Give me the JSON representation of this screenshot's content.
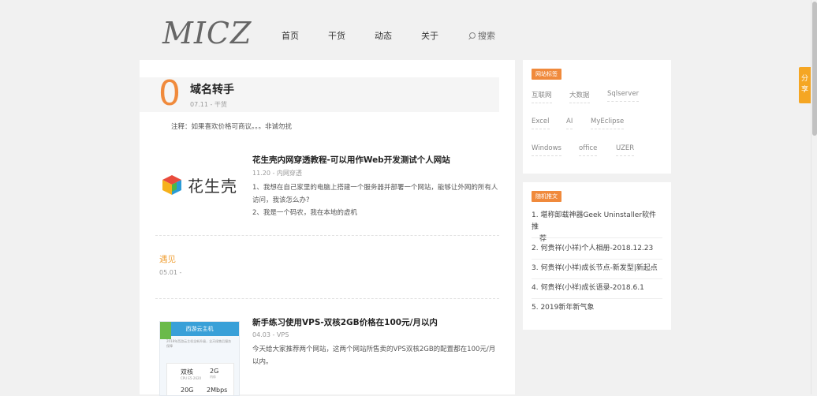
{
  "header": {
    "logo": "MICZ",
    "nav": [
      "首页",
      "干货",
      "动态",
      "关于"
    ],
    "search_label": "搜索"
  },
  "pinned": {
    "count": "0",
    "title": "域名转手",
    "date": "07.11",
    "category": "干货",
    "note": "注释：如果喜欢价格可商议。。。非诚勿扰"
  },
  "posts": [
    {
      "title": "花生壳内网穿透教程-可以用作Web开发测试个人网站",
      "date": "11.20",
      "category": "内网穿透",
      "lines": [
        "1、我想在自己家里的电脑上搭建一个服务器并部署一个网站，能够让外网的所有人",
        "访问，我该怎么办?",
        "2、我是一个码农，我在本地的虚机"
      ],
      "thumb_text": "花生壳"
    },
    {
      "title": "遇见",
      "date": "05.01",
      "category": ""
    },
    {
      "title": "新手练习使用VPS-双核2GB价格在100元/月以内",
      "date": "04.03",
      "category": "VPS",
      "lines": [
        "今天给大家推荐两个网站，这两个网站所售卖的VPS双核2GB的配置都在100元/月",
        "以内。"
      ],
      "thumb": {
        "bar": "西游云主机",
        "small": "2018年西游云主机全新升级，全天候售后服务保障",
        "spec1": "双核",
        "spec1_sub": "CPU E5-2620",
        "spec2": "2G",
        "spec2_sub": "内存",
        "spec3": "20G",
        "spec4": "2Mbps"
      }
    }
  ],
  "sidebar": {
    "tags_title": "网站标签",
    "tags": [
      "互联网",
      "大数据",
      "Sqlserver",
      "Excel",
      "AI",
      "MyEclipse",
      "Windows",
      "office",
      "UZER"
    ],
    "random_title": "随机推文",
    "random": [
      {
        "line1": "1. 堪称卸载神器Geek Uninstaller软件推",
        "line2": "荐"
      },
      {
        "line1": "2. 何贵祥(小祥)个人相册-2018.12.23"
      },
      {
        "line1": "3. 何贵祥(小祥)成长节点-新发型|新起点"
      },
      {
        "line1": "4. 何贵祥(小祥)成长语录-2018.6.1"
      },
      {
        "line1": "5. 2019新年新气象"
      }
    ]
  },
  "share": {
    "line1": "分",
    "line2": "享"
  },
  "colors": {
    "accent": "#f08a3c",
    "share": "#f5a623",
    "thumb_bar": "#39a0d8"
  }
}
